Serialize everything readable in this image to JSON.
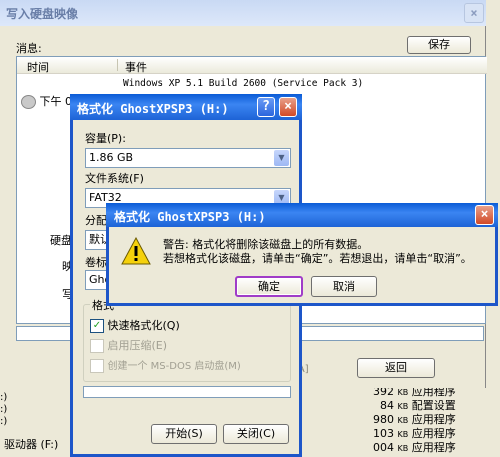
{
  "main_window": {
    "title": "写入硬盘映像",
    "messages_label": "消息:",
    "save_button": "保存",
    "log_columns": [
      "时间",
      "事件"
    ],
    "log_event": "Windows XP 5.1 Build 2600 (Service Pack 3)",
    "log_time_partial": "下午 0",
    "side_labels": [
      "硬盘",
      "映",
      "写"
    ],
    "unit_partial": "[A]",
    "back_button": "返回"
  },
  "background": {
    "lines": [
      ":)",
      ":)",
      ":)",
      "驱动器 (F:)"
    ],
    "file_list": [
      {
        "size": "392",
        "unit": "KB",
        "type": "应用程序"
      },
      {
        "size": "84",
        "unit": "KB",
        "type": "配置设置"
      },
      {
        "size": "980",
        "unit": "KB",
        "type": "应用程序"
      },
      {
        "size": "103",
        "unit": "KB",
        "type": "应用程序"
      },
      {
        "size": "004",
        "unit": "KB",
        "type": "应用程序"
      }
    ]
  },
  "format_dialog": {
    "title": "格式化 GhostXPSP3 (H:)",
    "capacity_label": "容量(P):",
    "capacity_value": "1.86 GB",
    "filesystem_label": "文件系统(F)",
    "filesystem_value": "FAT32",
    "alloc_label": "分配",
    "alloc_value": "默认",
    "volume_label": "卷标",
    "volume_value": "Ghos",
    "format_options_partial": "格式",
    "quick_format": "快速格式化(Q)",
    "compression": "启用压缩(E)",
    "msdos_disk": "创建一个 MS-DOS 启动盘(M)",
    "start_button": "开始(S)",
    "close_button": "关闭(C)"
  },
  "warning_dialog": {
    "title": "格式化 GhostXPSP3 (H:)",
    "line1": "警告: 格式化将删除该磁盘上的所有数据。",
    "line2": "若想格式化该磁盘，请单击“确定”。若想退出，请单击“取消”。",
    "ok_button": "确定",
    "cancel_button": "取消"
  },
  "colors": {
    "title_blue": "#1d63d6",
    "face": "#ece9d8",
    "close_red": "#d24a27",
    "warning_yellow": "#f5d10c"
  }
}
